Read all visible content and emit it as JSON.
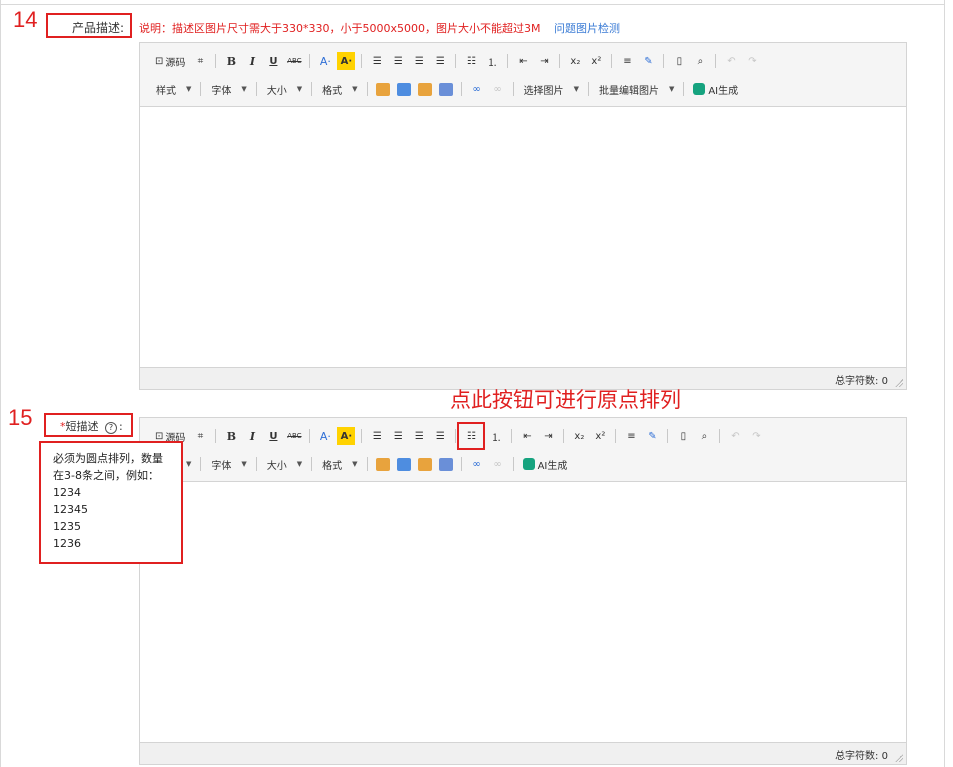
{
  "steps": {
    "step14": "14",
    "step15": "15"
  },
  "product_desc": {
    "label": "产品描述:",
    "note": "说明：描述区图片尺寸需大于330*330，小于5000x5000，图片大小不能超过3M",
    "note_link": "问题图片检测"
  },
  "short_desc": {
    "required_mark": "*",
    "label": "短描述",
    "help_icon": "?",
    "colon": ":"
  },
  "toolbar": {
    "source": "源码",
    "bold": "B",
    "italic": "I",
    "underline": "U",
    "strike": "ABC",
    "font_color": "A·",
    "highlight": "A·",
    "subscript": "x₂",
    "superscript": "x²",
    "style": "样式",
    "font": "字体",
    "size": "大小",
    "format": "格式",
    "select_image": "选择图片",
    "batch_edit_image": "批量编辑图片",
    "ai_generate": "AI生成"
  },
  "word_count": {
    "label": "总字符数:",
    "value": "0"
  },
  "annotation": "点此按钮可进行原点排列",
  "tooltip": {
    "lines": [
      "必须为圆点排列，数量",
      "在3-8条之间，例如：",
      "1234",
      "12345",
      "1235",
      "1236"
    ]
  },
  "colors": {
    "annotation_red": "#e02020",
    "link_blue": "#3a7bd5",
    "highlight_yellow": "#ffd200",
    "ai_green": "#16a37f"
  }
}
